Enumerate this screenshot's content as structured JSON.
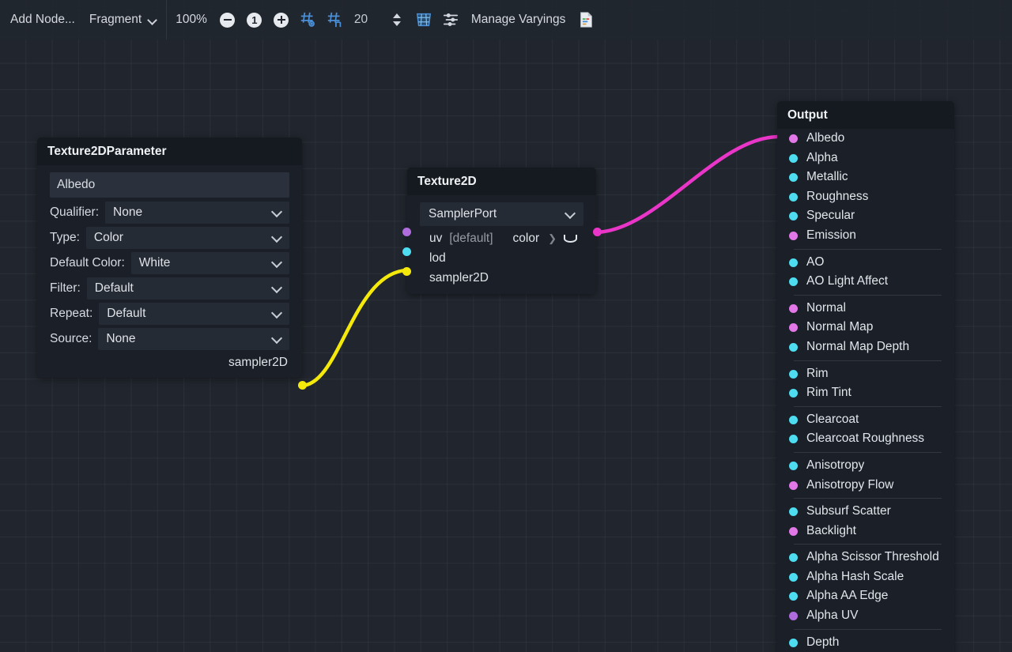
{
  "toolbar": {
    "add_node_label": "Add Node...",
    "shader_stage": "Fragment",
    "zoom_level": "100%",
    "zoom_out_icon": "minus-circle-icon",
    "zoom_reset_icon": "one-circle-icon",
    "zoom_in_icon": "plus-circle-icon",
    "grid_snap_icon": "grid-snap-icon",
    "grid_size_icon": "grid-size-icon",
    "grid_value": "20",
    "spinner_icon": "updown-spinner-icon",
    "toggle_grid_icon": "toggle-grid-icon",
    "alignment_icon": "alignment-icon",
    "manage_varyings_label": "Manage Varyings",
    "shader_code_icon": "shader-code-icon"
  },
  "nodes": {
    "texture2d_parameter": {
      "title": "Texture2DParameter",
      "name_value": "Albedo",
      "fields": [
        {
          "label": "Qualifier:",
          "value": "None"
        },
        {
          "label": "Type:",
          "value": "Color"
        },
        {
          "label": "Default Color:",
          "value": "White"
        },
        {
          "label": "Filter:",
          "value": "Default"
        },
        {
          "label": "Repeat:",
          "value": "Default"
        },
        {
          "label": "Source:",
          "value": "None"
        }
      ],
      "output_slot": "sampler2D"
    },
    "texture2d": {
      "title": "Texture2D",
      "sampler_port": "SamplerPort",
      "input_uv": "uv",
      "input_uv_default": "[default]",
      "output_color": "color",
      "input_lod": "lod",
      "input_sampler2d": "sampler2D"
    },
    "output": {
      "title": "Output",
      "groups": [
        {
          "slots": [
            {
              "label": "Albedo",
              "color": "pink"
            },
            {
              "label": "Alpha",
              "color": "cyan"
            },
            {
              "label": "Metallic",
              "color": "cyan"
            },
            {
              "label": "Roughness",
              "color": "cyan"
            },
            {
              "label": "Specular",
              "color": "cyan"
            },
            {
              "label": "Emission",
              "color": "pink"
            }
          ]
        },
        {
          "slots": [
            {
              "label": "AO",
              "color": "cyan"
            },
            {
              "label": "AO Light Affect",
              "color": "cyan"
            }
          ]
        },
        {
          "slots": [
            {
              "label": "Normal",
              "color": "pink"
            },
            {
              "label": "Normal Map",
              "color": "pink"
            },
            {
              "label": "Normal Map Depth",
              "color": "cyan"
            }
          ]
        },
        {
          "slots": [
            {
              "label": "Rim",
              "color": "cyan"
            },
            {
              "label": "Rim Tint",
              "color": "cyan"
            }
          ]
        },
        {
          "slots": [
            {
              "label": "Clearcoat",
              "color": "cyan"
            },
            {
              "label": "Clearcoat Roughness",
              "color": "cyan"
            }
          ]
        },
        {
          "slots": [
            {
              "label": "Anisotropy",
              "color": "cyan"
            },
            {
              "label": "Anisotropy Flow",
              "color": "pink"
            }
          ]
        },
        {
          "slots": [
            {
              "label": "Subsurf Scatter",
              "color": "cyan"
            },
            {
              "label": "Backlight",
              "color": "pink"
            }
          ]
        },
        {
          "slots": [
            {
              "label": "Alpha Scissor Threshold",
              "color": "cyan"
            },
            {
              "label": "Alpha Hash Scale",
              "color": "cyan"
            },
            {
              "label": "Alpha AA Edge",
              "color": "cyan"
            },
            {
              "label": "Alpha UV",
              "color": "purple"
            }
          ]
        },
        {
          "slots": [
            {
              "label": "Depth",
              "color": "cyan"
            }
          ]
        }
      ]
    }
  },
  "connections": [
    {
      "name": "sampler2d-link",
      "color": "#f5e80b"
    },
    {
      "name": "color-to-albedo-link",
      "color": "#e935c8"
    }
  ],
  "colors": {
    "canvas_bg": "#21262e",
    "node_bg": "#1b2028",
    "node_header_bg": "#151920",
    "field_bg": "#2b313c",
    "dropdown_bg": "#252b35",
    "accent_blue": "#4a90d9",
    "port_magenta": "#e935c8",
    "port_pink": "#e278e8",
    "port_purple": "#b06bdc",
    "port_cyan": "#4ddcf0",
    "port_yellow": "#f5e80b"
  }
}
